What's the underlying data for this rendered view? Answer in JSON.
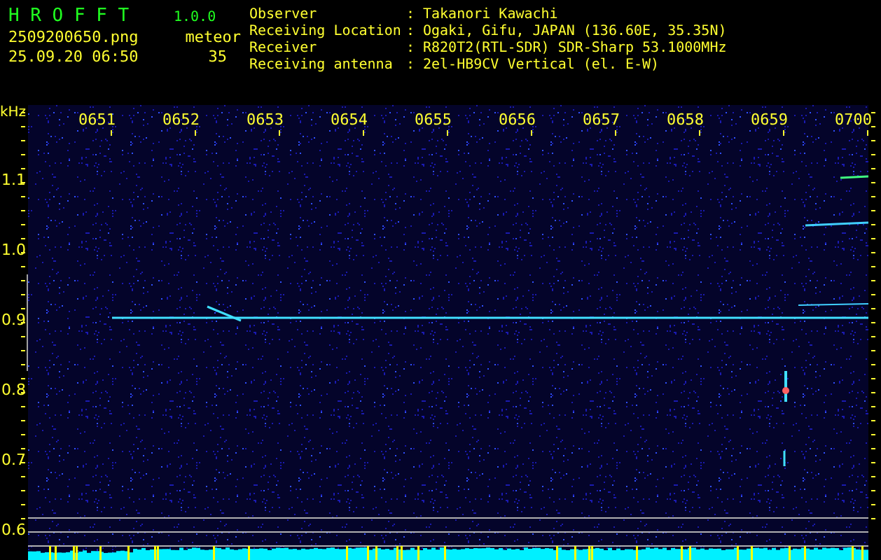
{
  "app": {
    "name": "H R O F F T",
    "version": "1.0.0"
  },
  "file": {
    "name": "2509200650.png",
    "timestamp": "25.09.20 06:50"
  },
  "mode": {
    "label": "meteor",
    "count": "35"
  },
  "station_info": [
    {
      "label": "Observer",
      "separator": ":",
      "value": "Takanori Kawachi"
    },
    {
      "label": "Receiving Location",
      "separator": ":",
      "value": "Ogaki, Gifu, JAPAN (136.60E, 35.35N)"
    },
    {
      "label": "Receiver",
      "separator": ":",
      "value": "R820T2(RTL-SDR) SDR-Sharp 53.1000MHz"
    },
    {
      "label": "Receiving antenna",
      "separator": ":",
      "value": "2el-HB9CV Vertical (el. E-W)"
    }
  ],
  "spectrogram": {
    "unit": "kHz",
    "time_labels": [
      "0651",
      "0652",
      "0653",
      "0654",
      "0655",
      "0656",
      "0657",
      "0658",
      "0659",
      "0700"
    ],
    "frequency_labels": [
      "1.1",
      "1.0",
      "0.9",
      "0.8",
      "0.7",
      "0.6"
    ]
  }
}
